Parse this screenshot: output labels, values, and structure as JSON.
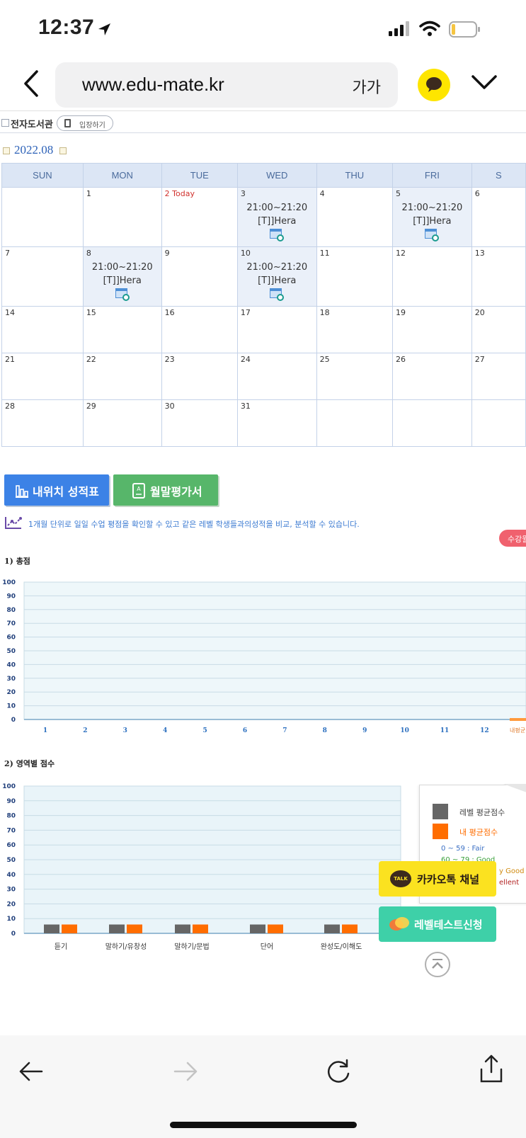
{
  "status_bar": {
    "time": "12:37"
  },
  "browser": {
    "url": "www.edu-mate.kr",
    "text_size_label": "가가"
  },
  "library": {
    "title": "전자도서관",
    "enter_label": "입장하기"
  },
  "calendar": {
    "month": "2022.08",
    "weekdays": [
      "SUN",
      "MON",
      "TUE",
      "WED",
      "THU",
      "FRI",
      "S"
    ],
    "today_label": "2 Today",
    "weeks": [
      [
        {
          "day": ""
        },
        {
          "day": "1"
        },
        {
          "day": "2 Today",
          "today": true
        },
        {
          "day": "3",
          "time": "21:00~21:20",
          "name": "[T]]Hera"
        },
        {
          "day": "4"
        },
        {
          "day": "5",
          "time": "21:00~21:20",
          "name": "[T]]Hera"
        },
        {
          "day": "6"
        }
      ],
      [
        {
          "day": "7"
        },
        {
          "day": "8",
          "time": "21:00~21:20",
          "name": "[T]]Hera"
        },
        {
          "day": "9"
        },
        {
          "day": "10",
          "time": "21:00~21:20",
          "name": "[T]]Hera"
        },
        {
          "day": "11"
        },
        {
          "day": "12"
        },
        {
          "day": "13"
        }
      ],
      [
        {
          "day": "14"
        },
        {
          "day": "15"
        },
        {
          "day": "16"
        },
        {
          "day": "17"
        },
        {
          "day": "18"
        },
        {
          "day": "19"
        },
        {
          "day": "20"
        }
      ],
      [
        {
          "day": "21"
        },
        {
          "day": "22"
        },
        {
          "day": "23"
        },
        {
          "day": "24"
        },
        {
          "day": "25"
        },
        {
          "day": "26"
        },
        {
          "day": "27"
        }
      ],
      [
        {
          "day": "28"
        },
        {
          "day": "29"
        },
        {
          "day": "30"
        },
        {
          "day": "31"
        },
        {
          "day": ""
        },
        {
          "day": ""
        },
        {
          "day": ""
        }
      ]
    ]
  },
  "buttons": {
    "report": "내위치 성적표",
    "monthly": "월말평가서"
  },
  "description": "1개월 단위로 일일 수업 평점을 확인할 수 있고 같은 레벨 학생들과의성적을 비교, 분석할 수 있습니다.",
  "period_button": "수강월차 선",
  "section1_title": "1) 총점",
  "section2_title": "2) 영역별 점수",
  "legend": {
    "level_avg": "레벨 평균점수",
    "my_avg": "내 평균점수",
    "grades": [
      "0 ~ 59 : Fair",
      "60 ~ 79 : Good",
      "y Good",
      "ellent"
    ],
    "level_color": "#666666",
    "my_color": "#ff6d00"
  },
  "floating": {
    "kakao_channel": "카카오톡 채널",
    "kakao_talk": "TALK",
    "level_test": "레벨테스트신청"
  },
  "chart_data": [
    {
      "type": "line",
      "title": "1) 총점",
      "x": [
        "1",
        "2",
        "3",
        "4",
        "5",
        "6",
        "7",
        "8",
        "9",
        "10",
        "11",
        "12"
      ],
      "x_extra_label": "내평균",
      "series": [],
      "ylim": [
        0,
        100
      ],
      "yticks": [
        0,
        10,
        20,
        30,
        40,
        50,
        60,
        70,
        80,
        90,
        100
      ],
      "grid": true
    },
    {
      "type": "bar",
      "title": "2) 영역별 점수",
      "categories": [
        "듣기",
        "말하기/유창성",
        "말하기/문법",
        "단어",
        "완성도/이해도"
      ],
      "series": [
        {
          "name": "레벨 평균점수",
          "values": [
            6,
            6,
            6,
            6,
            6
          ],
          "color": "#666666"
        },
        {
          "name": "내 평균점수",
          "values": [
            6,
            6,
            6,
            6,
            6
          ],
          "color": "#ff6d00"
        }
      ],
      "ylim": [
        0,
        100
      ],
      "yticks": [
        0,
        10,
        20,
        30,
        40,
        50,
        60,
        70,
        80,
        90,
        100
      ],
      "grid": true
    }
  ]
}
